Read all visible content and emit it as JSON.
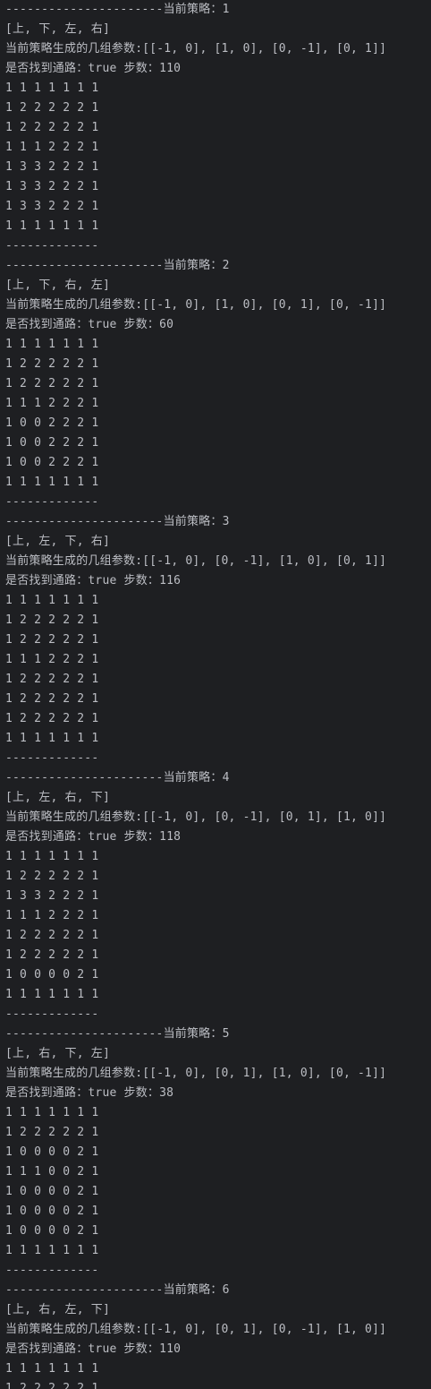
{
  "console": {
    "lines": [
      "----------------------当前策略：1",
      "[上, 下, 左, 右]",
      "当前策略生成的几组参数:[[-1, 0], [1, 0], [0, -1], [0, 1]]",
      "是否找到通路：true 步数：110",
      "1 1 1 1 1 1 1",
      "1 2 2 2 2 2 1",
      "1 2 2 2 2 2 1",
      "1 1 1 2 2 2 1",
      "1 3 3 2 2 2 1",
      "1 3 3 2 2 2 1",
      "1 3 3 2 2 2 1",
      "1 1 1 1 1 1 1",
      "-------------",
      "----------------------当前策略：2",
      "[上, 下, 右, 左]",
      "当前策略生成的几组参数:[[-1, 0], [1, 0], [0, 1], [0, -1]]",
      "是否找到通路：true 步数：60",
      "1 1 1 1 1 1 1",
      "1 2 2 2 2 2 1",
      "1 2 2 2 2 2 1",
      "1 1 1 2 2 2 1",
      "1 0 0 2 2 2 1",
      "1 0 0 2 2 2 1",
      "1 0 0 2 2 2 1",
      "1 1 1 1 1 1 1",
      "-------------",
      "----------------------当前策略：3",
      "[上, 左, 下, 右]",
      "当前策略生成的几组参数:[[-1, 0], [0, -1], [1, 0], [0, 1]]",
      "是否找到通路：true 步数：116",
      "1 1 1 1 1 1 1",
      "1 2 2 2 2 2 1",
      "1 2 2 2 2 2 1",
      "1 1 1 2 2 2 1",
      "1 2 2 2 2 2 1",
      "1 2 2 2 2 2 1",
      "1 2 2 2 2 2 1",
      "1 1 1 1 1 1 1",
      "-------------",
      "----------------------当前策略：4",
      "[上, 左, 右, 下]",
      "当前策略生成的几组参数:[[-1, 0], [0, -1], [0, 1], [1, 0]]",
      "是否找到通路：true 步数：118",
      "1 1 1 1 1 1 1",
      "1 2 2 2 2 2 1",
      "1 3 3 2 2 2 1",
      "1 1 1 2 2 2 1",
      "1 2 2 2 2 2 1",
      "1 2 2 2 2 2 1",
      "1 0 0 0 0 2 1",
      "1 1 1 1 1 1 1",
      "-------------",
      "----------------------当前策略：5",
      "[上, 右, 下, 左]",
      "当前策略生成的几组参数:[[-1, 0], [0, 1], [1, 0], [0, -1]]",
      "是否找到通路：true 步数：38",
      "1 1 1 1 1 1 1",
      "1 2 2 2 2 2 1",
      "1 0 0 0 0 2 1",
      "1 1 1 0 0 2 1",
      "1 0 0 0 0 2 1",
      "1 0 0 0 0 2 1",
      "1 0 0 0 0 2 1",
      "1 1 1 1 1 1 1",
      "-------------",
      "----------------------当前策略：6",
      "[上, 右, 左, 下]",
      "当前策略生成的几组参数:[[-1, 0], [0, 1], [0, -1], [1, 0]]",
      "是否找到通路：true 步数：110",
      "1 1 1 1 1 1 1",
      "1 2 2 2 2 2 1"
    ]
  }
}
